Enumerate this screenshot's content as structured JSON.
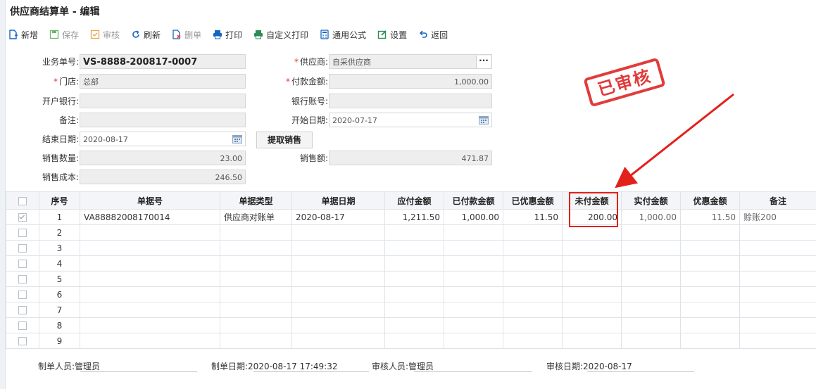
{
  "window": {
    "title": "供应商结算单 - 编辑"
  },
  "toolbar": {
    "new": "新增",
    "save": "保存",
    "audit": "审核",
    "refresh": "刷新",
    "delete": "删单",
    "print": "打印",
    "custom_print": "自定义打印",
    "formula": "通用公式",
    "settings": "设置",
    "back": "返回"
  },
  "form": {
    "order_no_label": "业务单号:",
    "order_no": "VS-8888-200817-0007",
    "supplier_label": "供应商:",
    "supplier": "自采供应商",
    "store_label": "门店:",
    "store": "总部",
    "pay_amount_label": "付款金额:",
    "pay_amount": "1,000.00",
    "bank_label": "开户银行:",
    "bank": "",
    "account_label": "银行账号:",
    "account": "",
    "remark_label": "备注:",
    "remark": "",
    "start_date_label": "开始日期:",
    "start_date": "2020-07-17",
    "end_date_label": "结束日期:",
    "end_date": "2020-08-17",
    "fetch_button": "提取销售",
    "sales_qty_label": "销售数量:",
    "sales_qty": "23.00",
    "sales_amount_label": "销售额:",
    "sales_amount": "471.87",
    "sales_cost_label": "销售成本:",
    "sales_cost": "246.50"
  },
  "stamp": {
    "text": "已审核",
    "color": "#e23b3b"
  },
  "table": {
    "headers": [
      "序号",
      "单据号",
      "单据类型",
      "单据日期",
      "应付金额",
      "已付款金额",
      "已优惠金额",
      "未付金额",
      "实付金额",
      "优惠金额",
      "备注"
    ],
    "rows": [
      {
        "checked": true,
        "no": "1",
        "doc_no": "VA88882008170014",
        "doc_type": "供应商对账单",
        "doc_date": "2020-08-17",
        "payable": "1,211.50",
        "paid": "1,000.00",
        "discounted": "11.50",
        "unpaid": "200.00",
        "actual": "1,000.00",
        "discount": "11.50",
        "remark": "赊账200"
      },
      {
        "checked": false,
        "no": "2"
      },
      {
        "checked": false,
        "no": "3"
      },
      {
        "checked": false,
        "no": "4"
      },
      {
        "checked": false,
        "no": "5"
      },
      {
        "checked": false,
        "no": "6"
      },
      {
        "checked": false,
        "no": "7"
      },
      {
        "checked": false,
        "no": "8"
      },
      {
        "checked": false,
        "no": "9"
      }
    ]
  },
  "footer": {
    "maker_label": "制单人员:",
    "maker": "管理员",
    "make_date_label": "制单日期:",
    "make_date": "2020-08-17 17:49:32",
    "auditor_label": "审核人员:",
    "auditor": "管理员",
    "audit_date_label": "审核日期:",
    "audit_date": "2020-08-17"
  },
  "colors": {
    "highlight": "#e3201b",
    "accent_blue": "#1565c0",
    "accent_green": "#2e8b57"
  }
}
